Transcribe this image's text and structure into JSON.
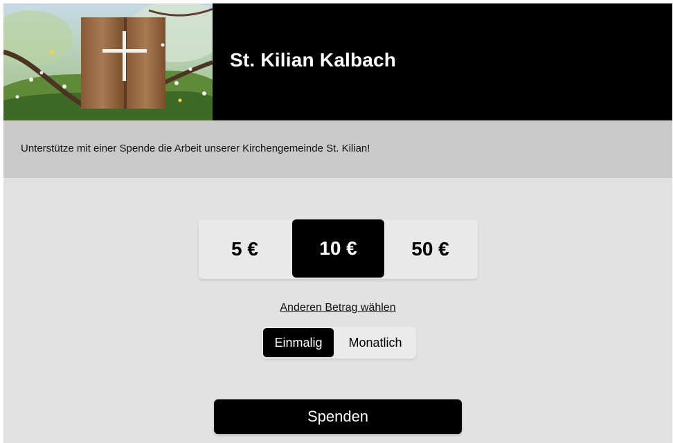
{
  "header": {
    "title": "St. Kilian Kalbach"
  },
  "intro": {
    "text": "Unterstütze mit einer Spende die Arbeit unserer Kirchengemeinde St. Kilian!"
  },
  "amounts": {
    "options": [
      "5 €",
      "10 €",
      "50 €"
    ],
    "selected": "10 €"
  },
  "other_amount_label": "Anderen Betrag wählen",
  "frequency": {
    "options": [
      "Einmalig",
      "Monatlich"
    ],
    "selected": "Einmalig"
  },
  "donate_label": "Spenden",
  "colors": {
    "accent": "#000000",
    "background": "#e2e2e2",
    "intro_band": "#c9c9c9"
  }
}
